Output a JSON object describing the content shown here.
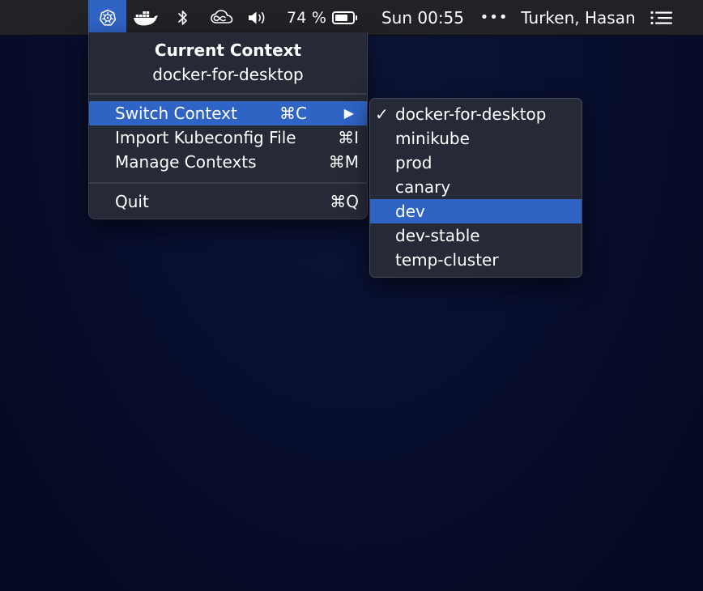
{
  "menubar": {
    "kubernetes_icon": "kubernetes-helm-wheel-icon",
    "docker_icon": "docker-whale-icon",
    "bluetooth_icon": "bluetooth-icon",
    "creative_cloud_icon": "creative-cloud-icon",
    "volume_icon": "speaker-volume-icon",
    "battery_percent": "74 %",
    "battery_level": 0.74,
    "clock": "Sun 00:55",
    "overflow_dots": "•••",
    "user_name": "Turken, Hasan",
    "notification_icon": "notification-center-list-icon",
    "accent_color": "#2f63c4"
  },
  "menu": {
    "header_title": "Current Context",
    "header_context": "docker-for-desktop",
    "items": [
      {
        "label": "Switch Context",
        "shortcut": "⌘C",
        "submenu_arrow": "▶",
        "highlighted": true
      },
      {
        "label": "Import Kubeconfig File",
        "shortcut": "⌘I"
      },
      {
        "label": "Manage Contexts",
        "shortcut": "⌘M"
      },
      {
        "label": "Quit",
        "shortcut": "⌘Q"
      }
    ]
  },
  "submenu": {
    "items": [
      {
        "label": "docker-for-desktop",
        "checkmark": "✓",
        "checked": true
      },
      {
        "label": "minikube"
      },
      {
        "label": "prod"
      },
      {
        "label": "canary"
      },
      {
        "label": "dev",
        "highlighted": true
      },
      {
        "label": "dev-stable"
      },
      {
        "label": "temp-cluster"
      }
    ]
  }
}
